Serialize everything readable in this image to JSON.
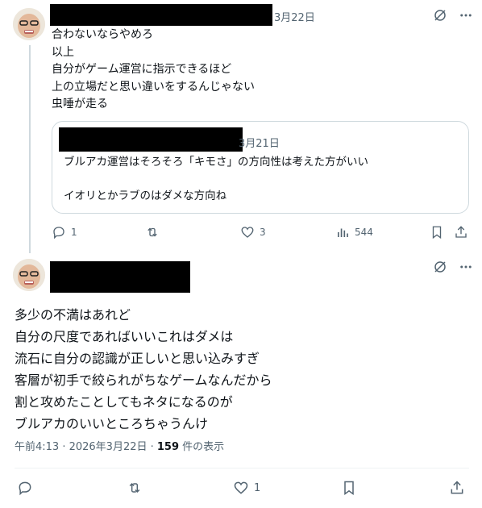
{
  "reply": {
    "date": "3月22日",
    "lines": [
      "合わないならやめろ",
      "以上",
      "自分がゲーム運営に指示できるほど",
      "上の立場だと思い違いをするんじゃない",
      "虫唾が走る"
    ],
    "quote": {
      "date": "3月21日",
      "line1": "ブルアカ運営はそろそろ「キモさ」の方向性は考えた方がいい",
      "line2": "イオリとかラブのはダメな方向ね"
    },
    "actions": {
      "reply_count": "1",
      "retweet_count": "",
      "like_count": "3",
      "view_count": "544"
    }
  },
  "main_post": {
    "lines": [
      "多少の不満はあれど",
      "自分の尺度であればいいこれはダメは",
      "流石に自分の認識が正しいと思い込みすぎ",
      "客層が初手で絞られがちなゲームなんだから",
      "割と攻めたことしてもネタになるのが",
      "ブルアカのいいところちゃうんけ"
    ],
    "timestamp": "午前4:13 · 2026年3月22日 · ",
    "views_count": "159",
    "views_label": " 件の表示",
    "actions": {
      "like_count": "1"
    }
  },
  "icons": {
    "grok": "grok-icon",
    "more": "more-icon",
    "reply": "reply-icon",
    "retweet": "retweet-icon",
    "like": "like-icon",
    "views": "views-icon",
    "bookmark": "bookmark-icon",
    "share": "share-icon"
  },
  "colors": {
    "text": "#0f1419",
    "secondary": "#536471",
    "border": "#cfd9de",
    "redaction": "#000000"
  }
}
